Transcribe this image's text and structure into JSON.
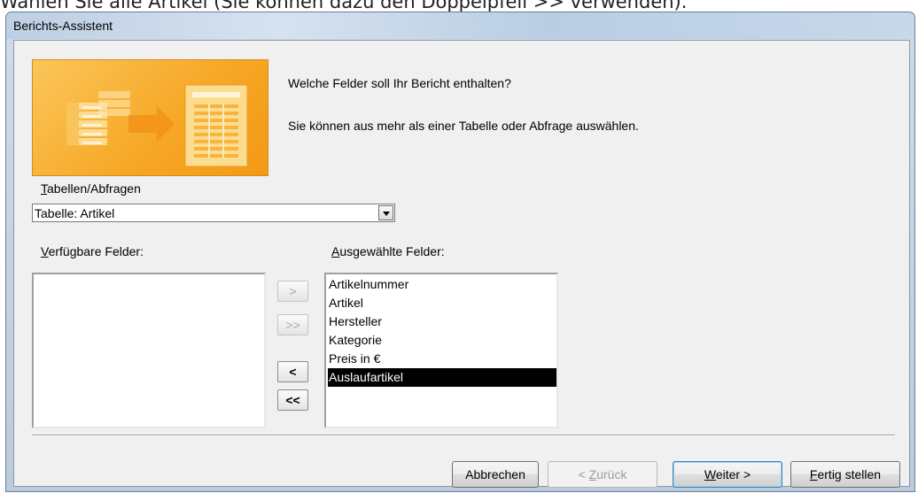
{
  "caption": "Wählen Sie alle Artikel (Sie können dazu den Doppelpfeil >> verwenden).",
  "window": {
    "title": "Berichts-Assistent"
  },
  "intro": {
    "question": "Welche Felder soll Ihr Bericht enthalten?",
    "hint": "Sie können aus mehr als einer Tabelle oder Abfrage auswählen."
  },
  "tables": {
    "label_accel": "T",
    "label_rest": "abellen/Abfragen",
    "selected": "Tabelle: Artikel"
  },
  "available": {
    "label_accel": "V",
    "label_rest": "erfügbare Felder:",
    "items": []
  },
  "selected_fields": {
    "label_accel": "A",
    "label_rest": "usgewählte Felder:",
    "items": [
      "Artikelnummer",
      "Artikel",
      "Hersteller",
      "Kategorie",
      "Preis in €",
      "Auslaufartikel"
    ],
    "selected_index": 5
  },
  "move_buttons": {
    "add_one": ">",
    "add_all": ">>",
    "remove_one": "<",
    "remove_all": "<<"
  },
  "buttons": {
    "cancel": "Abbrechen",
    "back_pre": "< ",
    "back_accel": "Z",
    "back_rest": "urück",
    "next_accel": "W",
    "next_rest": "eiter >",
    "finish_accel": "F",
    "finish_rest": "ertig stellen"
  },
  "colors": {
    "banner_orange": "#f6a624",
    "selection": "#000000",
    "default_button_border": "#3c7fb1"
  }
}
